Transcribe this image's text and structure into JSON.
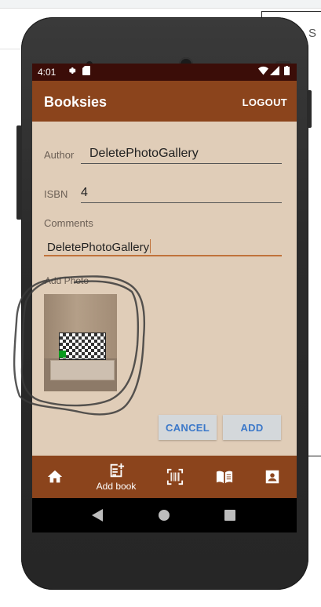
{
  "status_bar": {
    "time": "4:01"
  },
  "app_bar": {
    "title": "Booksies",
    "logout_label": "LOGOUT"
  },
  "form": {
    "author_label": "Author",
    "author_value": "DeletePhotoGallery",
    "isbn_label": "ISBN",
    "isbn_value": "4",
    "comments_label": "Comments",
    "comments_value": "DeletePhotoGallery",
    "add_photo_label": "Add Photo"
  },
  "actions": {
    "cancel_label": "CANCEL",
    "add_label": "ADD"
  },
  "bottom_nav": {
    "items": [
      {
        "icon": "home-icon",
        "label": ""
      },
      {
        "icon": "add-book-icon",
        "label": "Add book"
      },
      {
        "icon": "barcode-scan-icon",
        "label": ""
      },
      {
        "icon": "book-open-icon",
        "label": ""
      },
      {
        "icon": "account-box-icon",
        "label": ""
      }
    ]
  },
  "background": {
    "partial_text": "S"
  },
  "colors": {
    "app_bar": "#8b441c",
    "status_bar": "#3b0d08",
    "screen_background": "#e0cdb8",
    "accent": "#c0723a",
    "button_text": "#3b78c9"
  }
}
